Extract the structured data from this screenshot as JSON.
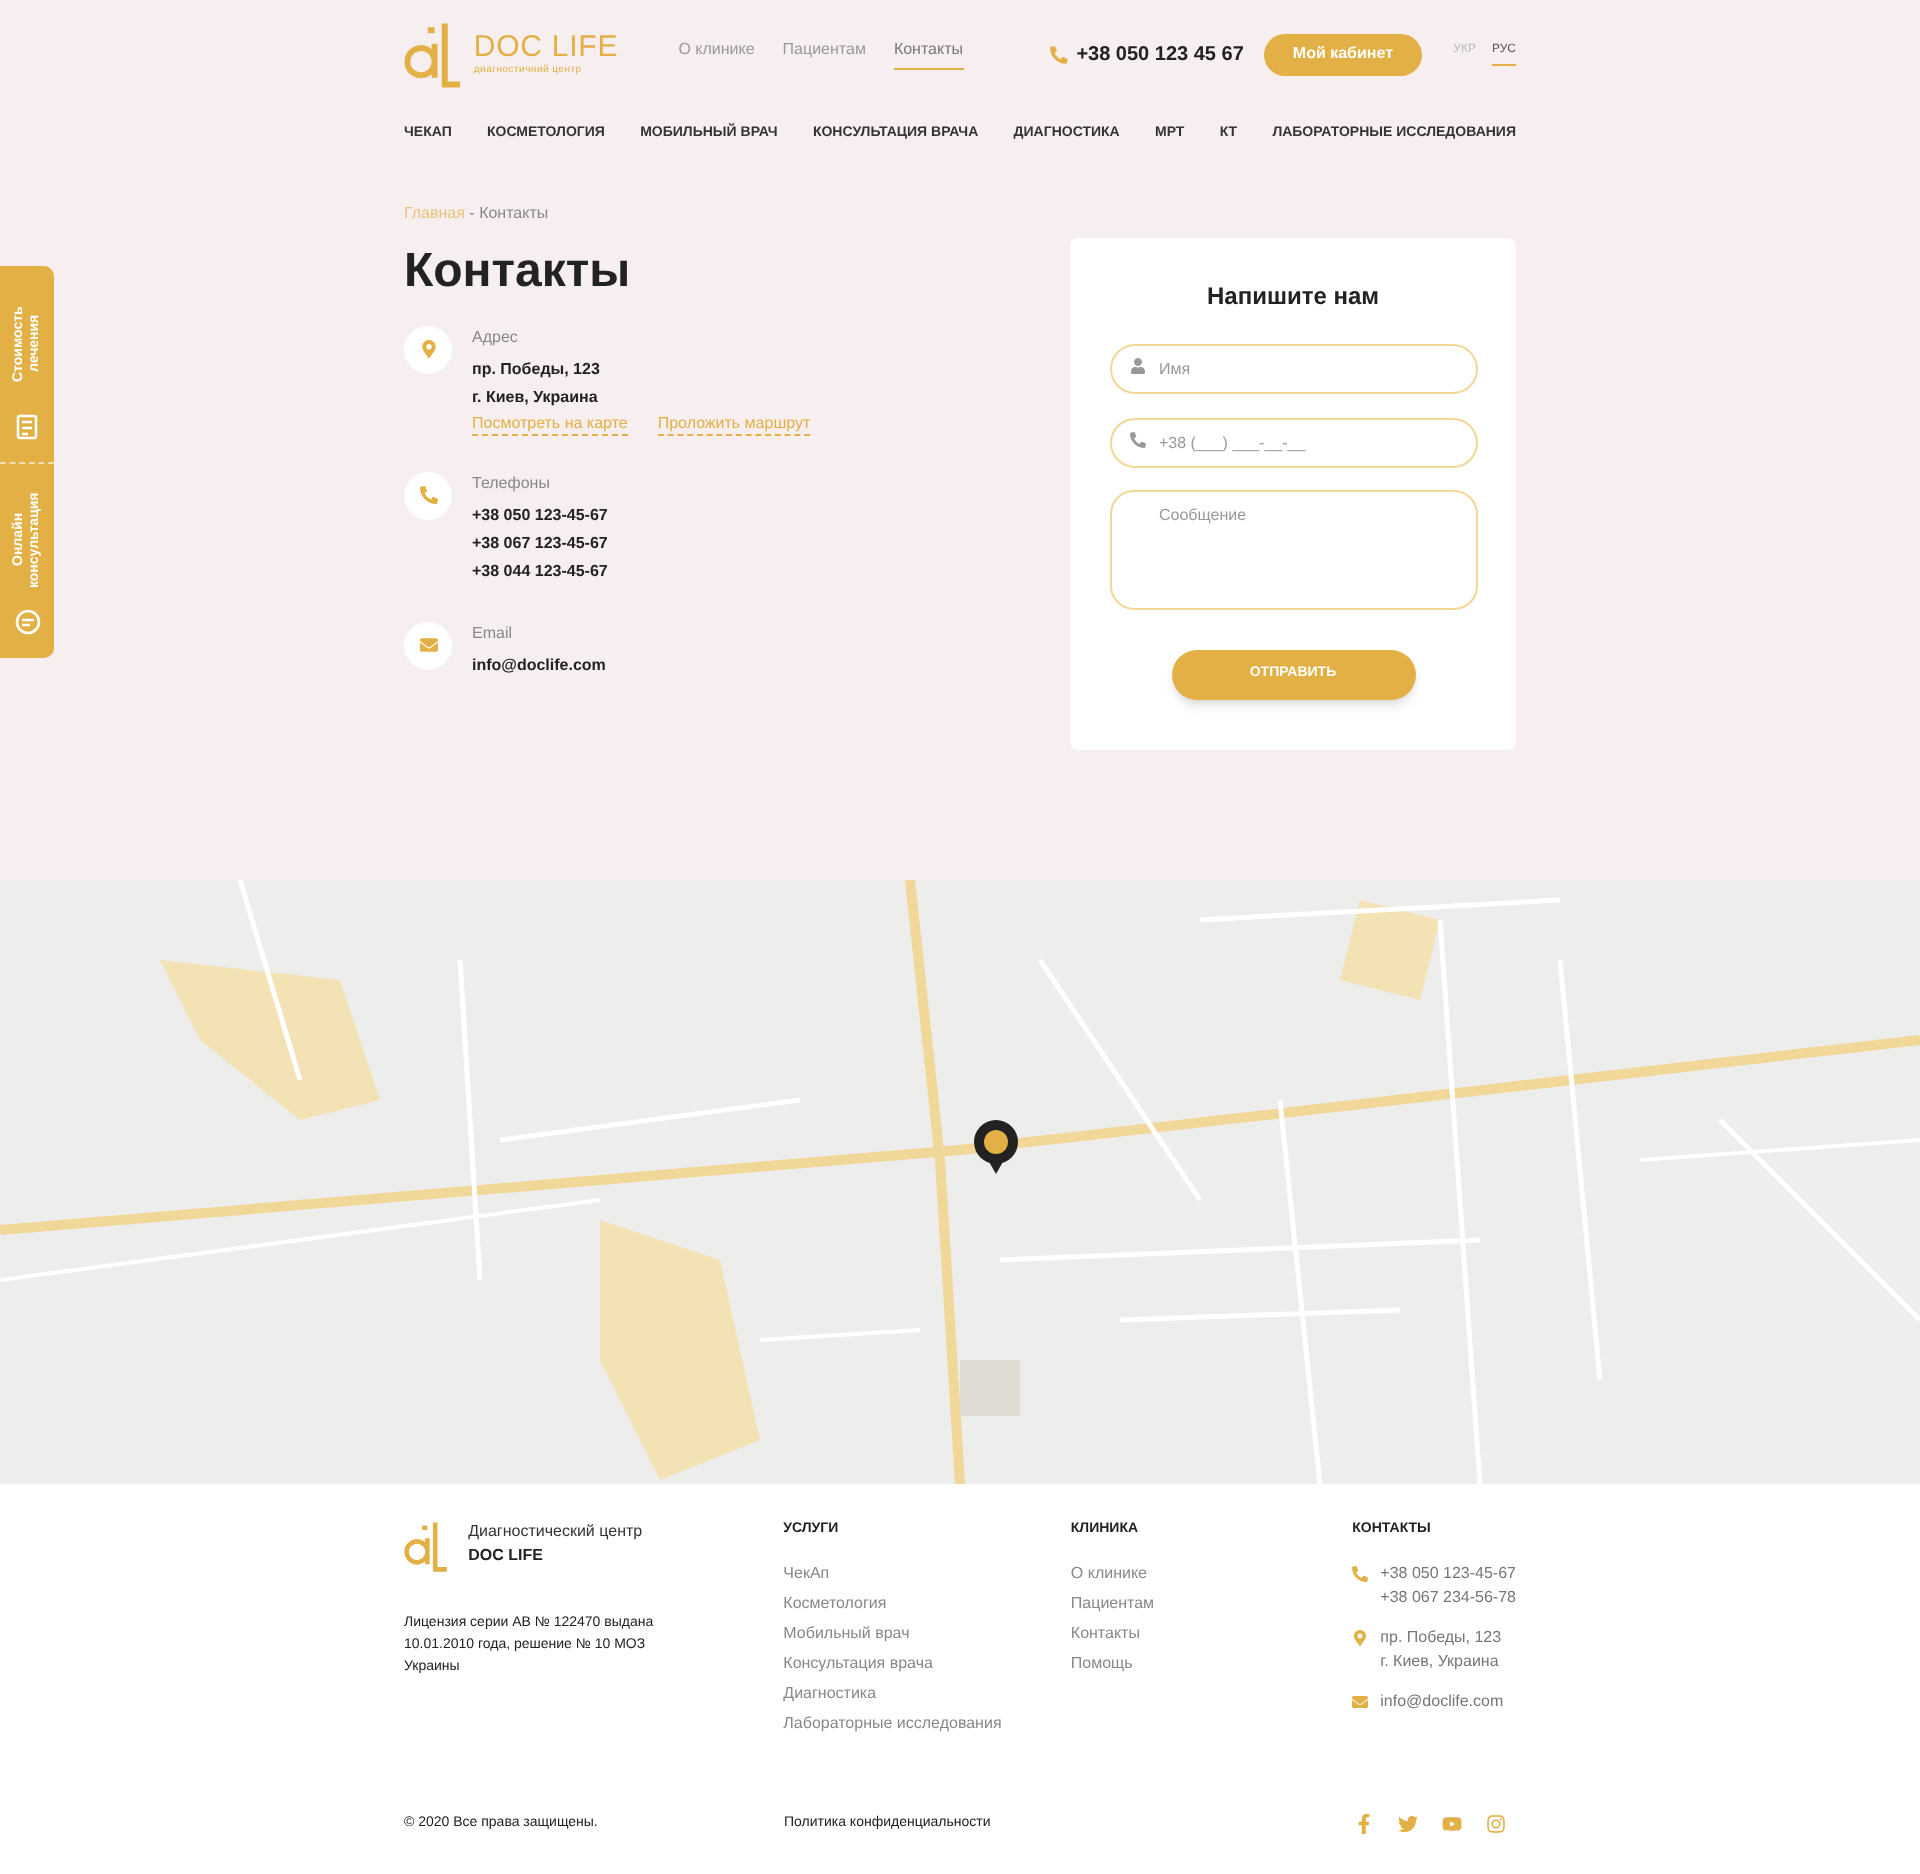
{
  "header": {
    "logo": {
      "name": "DOC LIFE",
      "tagline": "диагностичний центр"
    },
    "top_links": [
      {
        "label": "О клинике",
        "selected": false
      },
      {
        "label": "Пациентам",
        "selected": false
      },
      {
        "label": "Контакты",
        "selected": true
      }
    ],
    "phone": "+38 050 123 45 67",
    "cabinet_button": "Мой кабинет",
    "languages": [
      {
        "label": "УКР",
        "selected": false
      },
      {
        "label": "РУС",
        "selected": true
      }
    ],
    "nav": [
      "ЧЕКАП",
      "КОСМЕТОЛОГИЯ",
      "МОБИЛЬНЫЙ ВРАЧ",
      "КОНСУЛЬТАЦИЯ ВРАЧА",
      "ДИАГНОСТИКА",
      "МРТ",
      "КТ",
      "ЛАБОРАТОРНЫЕ ИССЛЕДОВАНИЯ"
    ]
  },
  "side_tabs": [
    {
      "kind": "price",
      "label": "Стоимость лечения"
    },
    {
      "kind": "chat",
      "label": "Онлайн консультация"
    }
  ],
  "breadcrumb": {
    "home": "Главная",
    "separator": " - ",
    "current": "Контакты"
  },
  "title": "Контакты",
  "contacts": [
    {
      "kind": "address",
      "label": "Адрес",
      "lines": [
        "пр. Победы, 123",
        "г. Киев, Украина"
      ],
      "links": [
        "Посмотреть на карте",
        "Проложить маршрут"
      ]
    },
    {
      "kind": "phone",
      "label": "Телефоны",
      "lines": [
        "+38 050 123-45-67",
        "+38 067 123-45-67",
        "+38 044 123-45-67"
      ]
    },
    {
      "kind": "email",
      "label": "Email",
      "lines": [
        "info@doclife.com"
      ]
    }
  ],
  "form": {
    "title": "Напишите нам",
    "fields": [
      {
        "kind": "name",
        "placeholder": "Имя"
      },
      {
        "kind": "phone",
        "placeholder": "+38 (___) ___-__-__"
      },
      {
        "kind": "message",
        "placeholder": "Сообщение"
      }
    ],
    "submit": "ОТПРАВИТЬ"
  },
  "footer": {
    "brand": {
      "subtitle": "Диагностический центр",
      "name": "DOC LIFE"
    },
    "license": "Лицензия серии АВ № 122470 выдана 10.01.2010 года, решение № 10 МОЗ Украины",
    "columns": [
      {
        "title": "УСЛУГИ",
        "items": [
          "ЧекАп",
          "Косметология",
          "Мобильный врач",
          "Консультация врача",
          "Диагностика",
          "Лабораторные исследования"
        ]
      },
      {
        "title": "КЛИНИКА",
        "items": [
          "О клинике",
          "Пациентам",
          "Контакты",
          "Помощь"
        ]
      }
    ],
    "contacts": {
      "title": "КОНТАКТЫ",
      "groups": [
        {
          "kind": "phone",
          "lines": [
            "+38 050 123-45-67",
            "+38 067 234-56-78"
          ]
        },
        {
          "kind": "address",
          "lines": [
            "пр. Победы, 123",
            "г. Киев, Украина"
          ]
        },
        {
          "kind": "email",
          "lines": [
            "info@doclife.com"
          ]
        }
      ]
    },
    "copyright": "© 2020 Все права защищены.",
    "privacy": "Политика конфиденциальности",
    "social": [
      {
        "kind": "facebook"
      },
      {
        "kind": "twitter"
      },
      {
        "kind": "youtube"
      },
      {
        "kind": "instagram"
      }
    ]
  }
}
